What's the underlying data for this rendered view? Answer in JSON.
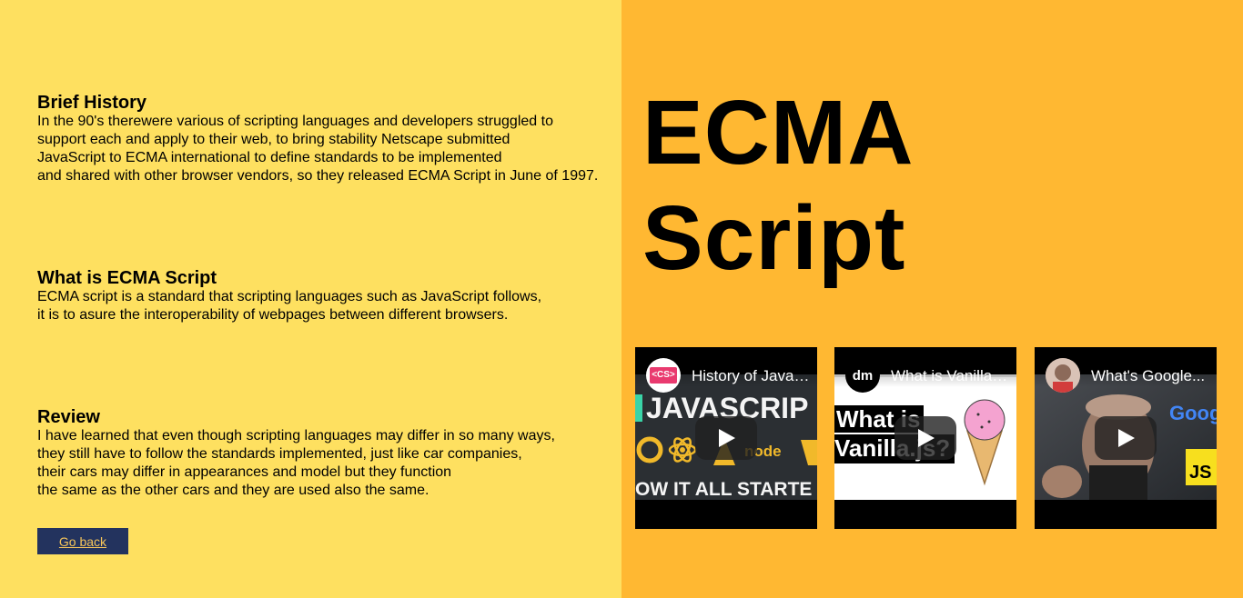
{
  "sections": [
    {
      "heading": "Brief History",
      "body": "In the 90's therewere various of scripting languages and developers struggled to\nsupport each and apply to their web, to bring stability Netscape submitted\nJavaScript to ECMA international to define standards to be implemented\nand shared with other browser vendors, so they released ECMA Script in June of 1997."
    },
    {
      "heading": "What is ECMA Script",
      "body": "ECMA script is a standard that scripting languages such as JavaScript follows,\nit is to asure the interoperability of webpages between different browsers."
    },
    {
      "heading": "Review",
      "body": "I have learned that even though scripting languages may differ in so many ways,\nthey still have to follow the standards implemented, just like car companies,\ntheir cars may differ in appearances and model but they function\nthe same as the other cars and they are used also the same."
    }
  ],
  "go_back_label": "Go back",
  "title": "ECMA\nScript",
  "videos": [
    {
      "title": "History of JavaScript",
      "channel_badge": "<CS>",
      "thumb_text": [
        "JAVASCRIP",
        "OW IT ALL STARTE",
        "node"
      ]
    },
    {
      "title": "What is Vanilla.js?",
      "channel_badge": "dm",
      "thumb_text": [
        "What is",
        "Vanilla.js?"
      ]
    },
    {
      "title": "What's Google...",
      "channel_badge": "",
      "thumb_text": [
        "Goog",
        "JS"
      ]
    }
  ],
  "colors": {
    "left_bg": "#fee060",
    "right_bg": "#ffb832",
    "button_bg": "#23335e",
    "button_text": "#f6c55a"
  }
}
